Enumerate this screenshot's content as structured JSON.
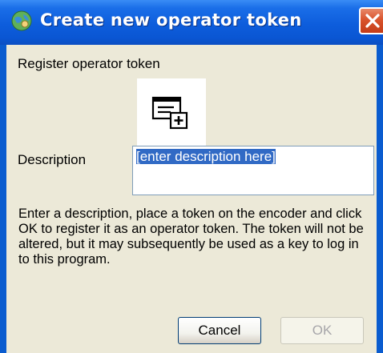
{
  "window": {
    "title": "Create new operator token",
    "close_label": "Close",
    "close_icon": "close-x-icon",
    "app_icon": "globe-person-icon"
  },
  "dialog": {
    "heading": "Register operator token",
    "token_icon": "token-card-icon",
    "description_label": "Description",
    "description_value": "[enter description here]",
    "help_text": "Enter a description, place a token on the encoder and click OK to register it as an operator token.  The token will not be altered, but it may subsequently be used as a key to log in to this program.",
    "cancel_label": "Cancel",
    "ok_label": "OK",
    "ok_enabled": false
  },
  "colors": {
    "titlebar": "#0a56d3",
    "client_bg": "#ece9d8",
    "selection": "#316ac5",
    "close_button": "#d9532c"
  }
}
